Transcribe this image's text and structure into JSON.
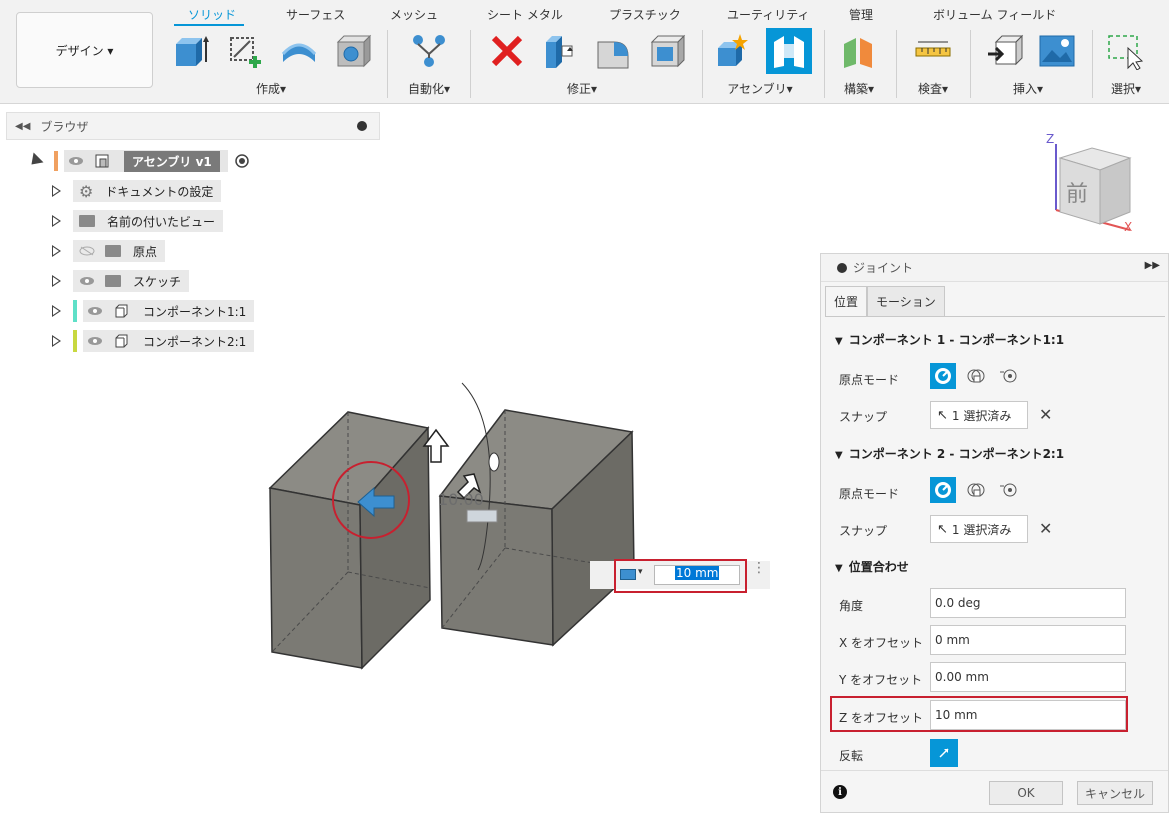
{
  "toolbar": {
    "workspace_label": "デザイン ▾",
    "tabs": [
      "ソリッド",
      "サーフェス",
      "メッシュ",
      "シート メタル",
      "プラスチック",
      "ユーティリティ",
      "管理",
      "ボリューム フィールド"
    ],
    "groups": [
      "作成▾",
      "自動化▾",
      "修正▾",
      "アセンブリ▾",
      "構築▾",
      "検査▾",
      "挿入▾",
      "選択▾"
    ]
  },
  "browser": {
    "title": "ブラウザ",
    "root": "アセンブリ v1",
    "items": [
      "ドキュメントの設定",
      "名前の付いたビュー",
      "原点",
      "スケッチ",
      "コンポーネント1:1",
      "コンポーネント2:1"
    ]
  },
  "viewport": {
    "dim_label": "10.00",
    "dim_input_value": "10 mm",
    "viewcube_face": "前",
    "axis_z": "Z",
    "axis_x": "X"
  },
  "joint": {
    "title": "ジョイント",
    "tabs": [
      "位置",
      "モーション"
    ],
    "comp1_header": "コンポーネント 1 - コンポーネント1:1",
    "comp2_header": "コンポーネント 2 - コンポーネント2:1",
    "origin_mode_label": "原点モード",
    "snap_label": "スナップ",
    "snap_value": "1 選択済み",
    "alignment_header": "位置合わせ",
    "angle_label": "角度",
    "angle_value": "0.0 deg",
    "x_offset_label": "X をオフセット",
    "x_offset_value": "0 mm",
    "y_offset_label": "Y をオフセット",
    "y_offset_value": "0.00 mm",
    "z_offset_label": "Z をオフセット",
    "z_offset_value": "10 mm",
    "flip_label": "反転",
    "ok_label": "OK",
    "cancel_label": "キャンセル"
  },
  "colors": {
    "accent": "#0696d7",
    "highlight_red": "#c8202f",
    "comp1_color": "#5fe0c8",
    "comp2_color": "#c8d840",
    "root_color": "#f0a060"
  }
}
